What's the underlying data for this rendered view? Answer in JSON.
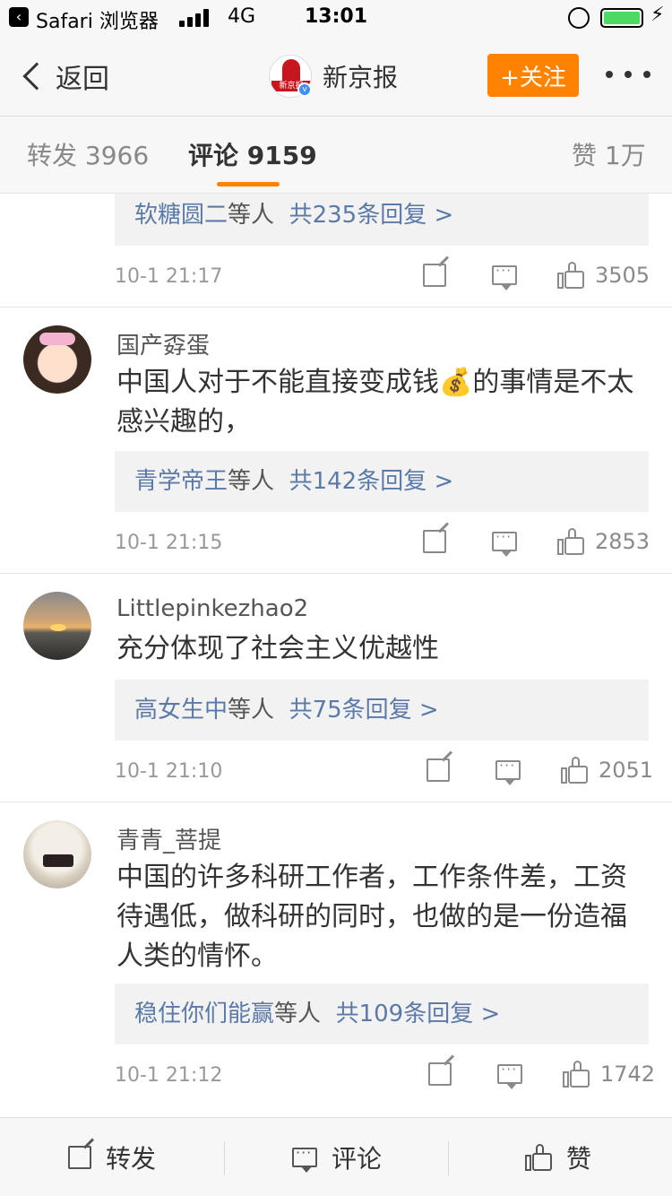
{
  "status_bar": {
    "app": "Safari 浏览器",
    "network": "4G",
    "time": "13:01",
    "charge_symbol": "⚡"
  },
  "nav": {
    "back_label": "返回",
    "account_name": "新京报",
    "avatar_text": "新京报",
    "verified_mark": "v",
    "follow_label": "+关注"
  },
  "tabs": {
    "repost": "转发 3966",
    "comments": "评论 9159",
    "likes": "赞 1万"
  },
  "comments": [
    {
      "reply_users": "软糖圆二",
      "reply_suffix": "等人",
      "reply_count": "共235条回复 >",
      "time": "10-1 21:17",
      "likes": "3505"
    },
    {
      "username": "国产孬蛋",
      "text": "中国人对于不能直接变成钱💰的事情是不太感兴趣的，",
      "reply_users": "青学帝王",
      "reply_suffix": "等人",
      "reply_count": "共142条回复 >",
      "time": "10-1 21:15",
      "likes": "2853"
    },
    {
      "username": "Littlepinkezhao2",
      "text": "充分体现了社会主义优越性",
      "reply_users": "高女生中",
      "reply_suffix": "等人",
      "reply_count": "共75条回复 >",
      "time": "10-1 21:10",
      "likes": "2051"
    },
    {
      "username": "青青_菩提",
      "text": "中国的许多科研工作者，工作条件差，工资待遇低，做科研的同时，也做的是一份造福人类的情怀。",
      "reply_users": "稳住你们能赢",
      "reply_suffix": "等人",
      "reply_count": "共109条回复 >",
      "time": "10-1 21:12",
      "likes": "1742"
    }
  ],
  "bottom_bar": {
    "repost": "转发",
    "comment": "评论",
    "like": "赞"
  },
  "colors": {
    "accent": "#ff8200",
    "link": "#5b7aa8",
    "verified": "#3f8ff0"
  }
}
